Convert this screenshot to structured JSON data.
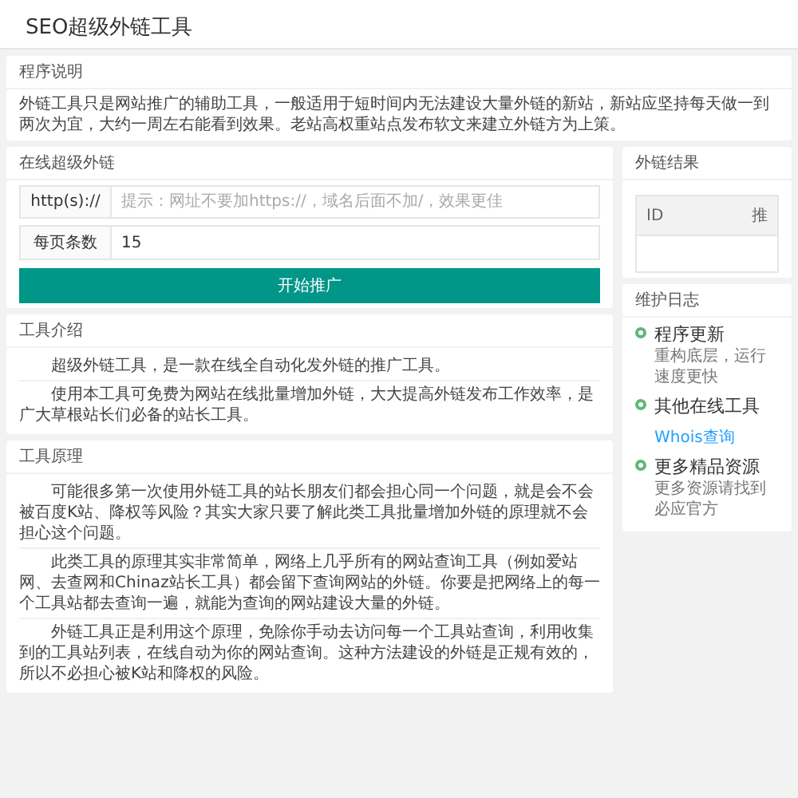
{
  "page_title": "SEO超级外链工具",
  "description": {
    "title": "程序说明",
    "text": "外链工具只是网站推广的辅助工具，一般适用于短时间内无法建设大量外链的新站，新站应坚持每天做一到两次为宜，大约一周左右能看到效果。老站高权重站点发布软文来建立外链方为上策。"
  },
  "form": {
    "title": "在线超级外链",
    "fields": [
      {
        "label": "http(s)://",
        "placeholder": "提示：网址不要加https://，域名后面不加/，效果更佳"
      },
      {
        "label": "每页条数",
        "value": "15"
      }
    ],
    "submit": "开始推广"
  },
  "results": {
    "title": "外链结果",
    "columns": [
      "ID",
      "推"
    ]
  },
  "intro": {
    "title": "工具介绍",
    "paragraphs": [
      "超级外链工具，是一款在线全自动化发外链的推广工具。",
      "使用本工具可免费为网站在线批量增加外链，大大提高外链发布工作效率，是广大草根站长们必备的站长工具。"
    ]
  },
  "principle": {
    "title": "工具原理",
    "paragraphs": [
      "可能很多第一次使用外链工具的站长朋友们都会担心同一个问题，就是会不会被百度K站、降权等风险？其实大家只要了解此类工具批量增加外链的原理就不会担心这个问题。",
      "此类工具的原理其实非常简单，网络上几乎所有的网站查询工具（例如爱站网、去查网和Chinaz站长工具）都会留下查询网站的外链。你要是把网络上的每一个工具站都去查询一遍，就能为查询的网站建设大量的外链。",
      "外链工具正是利用这个原理，免除你手动去访问每一个工具站查询，利用收集到的工具站列表，在线自动为你的网站查询。这种方法建设的外链是正规有效的，所以不必担心被K站和降权的风险。"
    ]
  },
  "log": {
    "title": "维护日志",
    "entries": [
      {
        "heading": "程序更新",
        "kind": "text",
        "text": "重构底层，运行速度更快"
      },
      {
        "heading": "其他在线工具",
        "kind": "link",
        "text": "Whois查询"
      },
      {
        "heading": "更多精品资源",
        "kind": "text",
        "text": "更多资源请找到必应官方"
      }
    ]
  }
}
